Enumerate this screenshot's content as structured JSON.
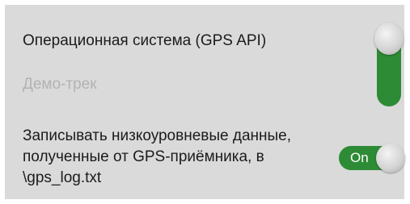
{
  "settings": {
    "gps_source": {
      "label": "Операционная система (GPS API)",
      "enabled": true
    },
    "demo_track": {
      "label": "Демо-трек",
      "enabled": false
    },
    "gps_log": {
      "label": "Записывать низкоуровневые данные, полученные от GPS-приёмника, в \\gps_log.txt",
      "state_text": "On",
      "enabled": true
    }
  },
  "colors": {
    "panel_background": "#dadada",
    "switch_on_track": "#2e8b35",
    "switch_thumb": "#d2d2d2",
    "primary_text": "#1b1b1b",
    "disabled_text": "#b3b3b3"
  }
}
